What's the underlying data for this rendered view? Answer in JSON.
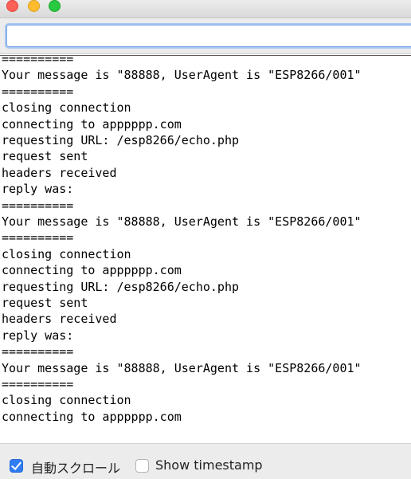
{
  "window": {
    "close_color": "#fe5f57",
    "minimize_color": "#febc2e",
    "zoom_color": "#28c840"
  },
  "send_input": {
    "value": "",
    "placeholder": ""
  },
  "serial_output": [
    "==========",
    "Your message is \"88888, UserAgent is \"ESP8266/001\"",
    "==========",
    "closing connection",
    "connecting to apppppp.com",
    "requesting URL: /esp8266/echo.php",
    "request sent",
    "headers received",
    "reply was:",
    "==========",
    "Your message is \"88888, UserAgent is \"ESP8266/001\"",
    "==========",
    "closing connection",
    "connecting to apppppp.com",
    "requesting URL: /esp8266/echo.php",
    "request sent",
    "headers received",
    "reply was:",
    "==========",
    "Your message is \"88888, UserAgent is \"ESP8266/001\"",
    "==========",
    "closing connection",
    "connecting to apppppp.com"
  ],
  "footer": {
    "autoscroll_label": "自動スクロール",
    "autoscroll_checked": true,
    "timestamp_label": "Show timestamp",
    "timestamp_checked": false
  }
}
